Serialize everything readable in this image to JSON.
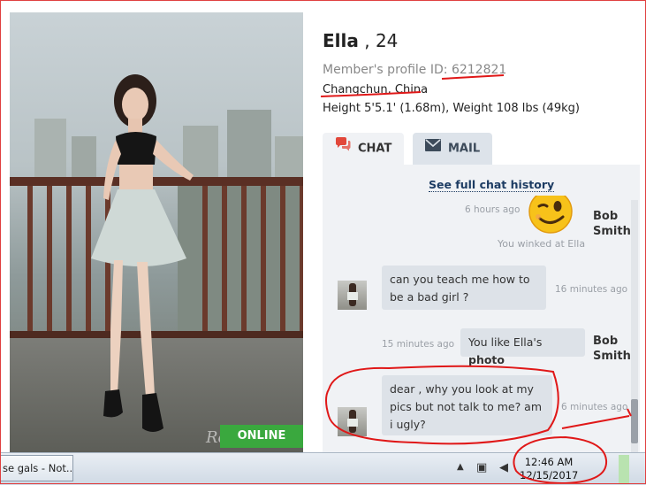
{
  "profile": {
    "name": "Ella",
    "age": "24",
    "profile_id_label": "Member's profile ID:",
    "profile_id": "6212821",
    "location": "Changchun, China",
    "height_weight": "Height 5'5.1' (1.68m), Weight 108 lbs (49kg)",
    "online_badge": "ONLINE NOW",
    "watermark": "Ro"
  },
  "tabs": [
    {
      "label": "CHAT",
      "icon": "chat-bubbles-icon",
      "active": true
    },
    {
      "label": "MAIL",
      "icon": "envelope-icon",
      "active": false
    }
  ],
  "chat": {
    "history_link": "See full chat history",
    "messages": [
      {
        "type": "wink",
        "time": "6 hours ago",
        "sender": "Bob Smith",
        "note": "You winked at Ella"
      },
      {
        "type": "incoming",
        "text": "can you teach me how to be a bad girl ?",
        "time": "16 minutes ago"
      },
      {
        "type": "outgoing",
        "text_prefix": "You like Ella's",
        "text_bold": "photo",
        "time": "15 minutes ago",
        "sender": "Bob Smith"
      },
      {
        "type": "incoming",
        "text": "dear , why you look at my pics but not talk to me? am i ugly?",
        "time": "6 minutes ago"
      }
    ]
  },
  "taskbar": {
    "window_title": "se gals - Not...",
    "clock_time": "12:46 AM",
    "clock_date": "12/15/2017"
  },
  "colors": {
    "annotation": "#e01818",
    "online": "#3aa83e",
    "chat_bg": "#f0f2f5",
    "bubble": "#dde2e8",
    "link": "#1d3c63"
  }
}
